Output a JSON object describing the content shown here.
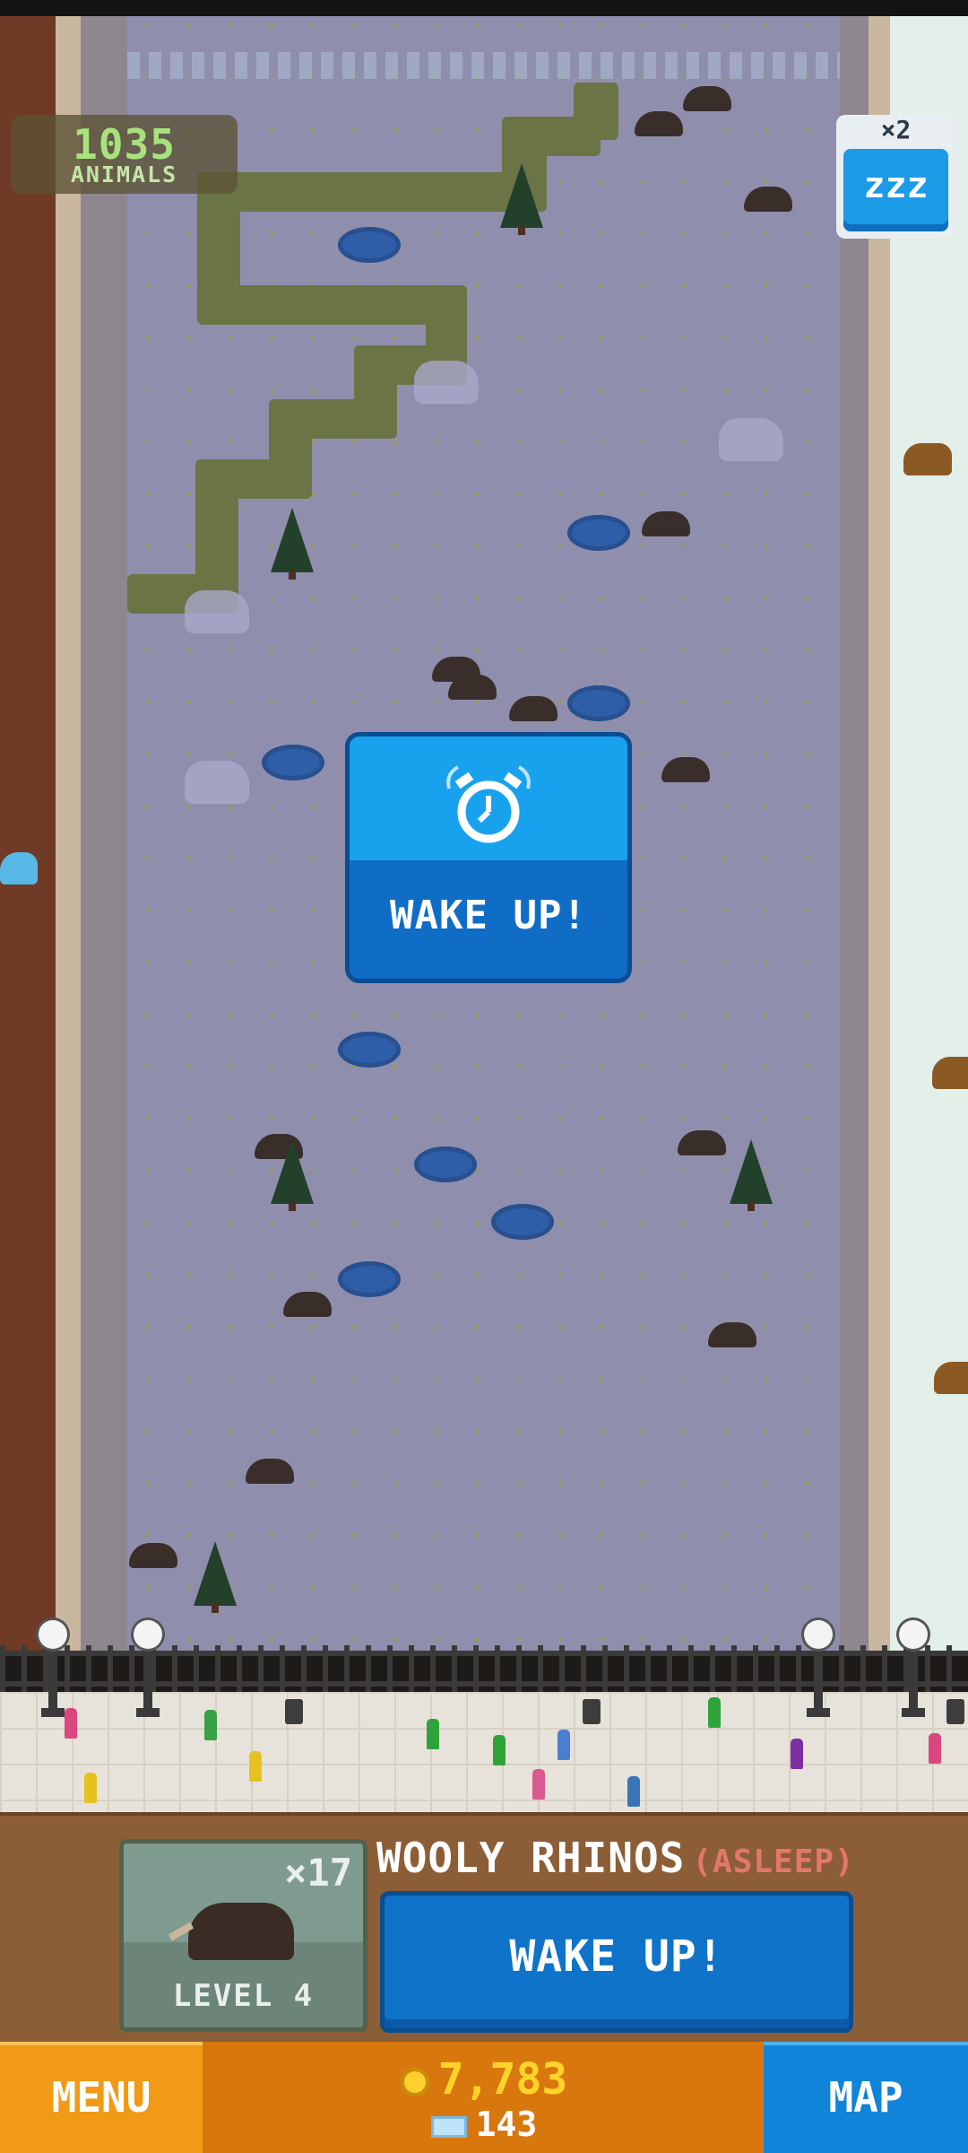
{
  "hud": {
    "animal_count": "1035",
    "animal_count_label": "ANIMALS",
    "sleep_multiplier": "×2",
    "sleep_icon_text": "zzz"
  },
  "center_popup": {
    "icon": "alarm-clock-icon",
    "label": "WAKE UP!"
  },
  "species_panel": {
    "count": "×17",
    "level": "LEVEL 4",
    "name": "WOOLY RHINOS",
    "status": "(ASLEEP)",
    "wake_button": "WAKE UP!"
  },
  "bottom_bar": {
    "menu": "MENU",
    "coins": "7,783",
    "gems": "143",
    "map": "MAP"
  },
  "colors": {
    "tundra": "#8f8fad",
    "button_blue": "#1b9be6",
    "menu_orange": "#f09a16",
    "coin_gold": "#ffd42a",
    "status_red": "#e2786b"
  }
}
